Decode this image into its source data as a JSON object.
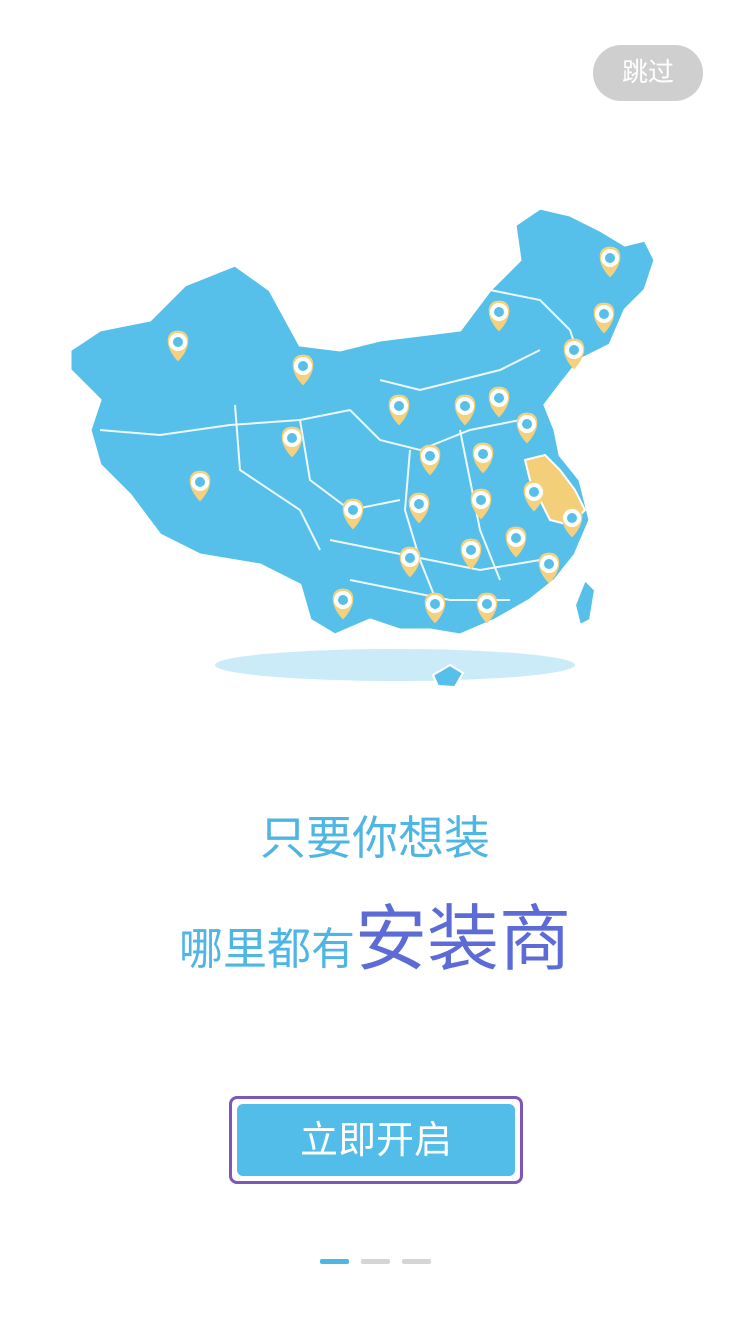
{
  "skip": {
    "label": "跳过"
  },
  "headline": {
    "line1": "只要你想装",
    "line2_normal": "哪里都有",
    "line2_highlight": "安装商"
  },
  "cta": {
    "label": "立即开启"
  },
  "pager": {
    "count": 3,
    "active_index": 0
  },
  "colors": {
    "map_blue": "#56c0ea",
    "highlight_region": "#f3cf7a",
    "pin_fill": "#f6d17d",
    "text_blue": "#4fb6e3",
    "text_purple": "#5c6bd6",
    "button_blue": "#52bde9",
    "button_border": "#7d56b8",
    "skip_bg": "#cfcfcf"
  },
  "map": {
    "icon": "china-map-with-installer-pins"
  }
}
